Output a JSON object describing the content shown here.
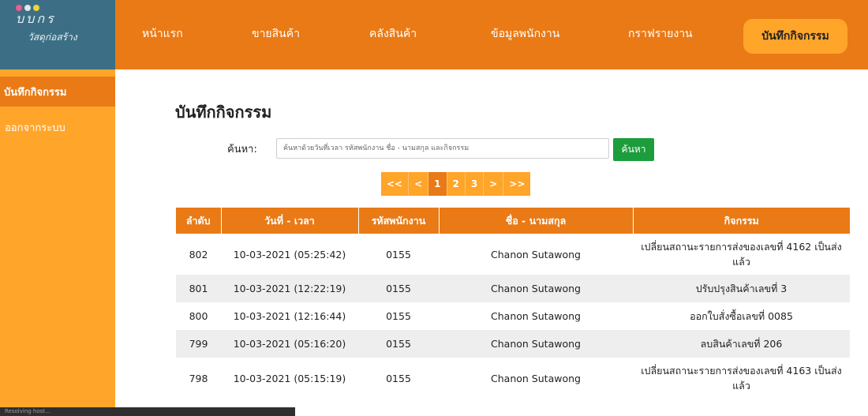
{
  "logo": {
    "title": "บบกร",
    "subtitle": "วัสดุก่อสร้าง",
    "dot_colors": [
      "#ef5a8f",
      "#e6e6e6",
      "#f2d23a"
    ]
  },
  "nav": {
    "items": [
      "หน้าแรก",
      "ขายสินค้า",
      "คลังสินค้า",
      "ข้อมูลพนักงาน",
      "กราฟรายงาน"
    ],
    "active": "บันทึกกิจกรรม"
  },
  "sidebar": {
    "active": "บันทึกกิจกรรม",
    "logout": "ออกจากระบบ"
  },
  "main": {
    "title": "บันทึกกิจกรรม",
    "search_label": "ค้นหา:",
    "search_placeholder": "ค้นหาด้วยวันที่เวลา รหัสพนักงาน ชื่อ - นามสกุล และกิจกรรม",
    "search_value": "",
    "search_button": "ค้นหา"
  },
  "pager": {
    "first": "<<",
    "prev": "<",
    "pages": [
      "1",
      "2",
      "3"
    ],
    "current": "1",
    "next": ">",
    "last": ">>"
  },
  "table": {
    "headers": [
      "ลำดับ",
      "วันที่ - เวลา",
      "รหัสพนักงาน",
      "ชื่อ - นามสกุล",
      "กิจกรรม"
    ],
    "rows": [
      [
        "802",
        "10-03-2021 (05:25:42)",
        "0155",
        "Chanon Sutawong",
        "เปลี่ยนสถานะรายการส่งของเลขที่ 4162 เป็นส่งแล้ว"
      ],
      [
        "801",
        "10-03-2021 (12:22:19)",
        "0155",
        "Chanon Sutawong",
        "ปรับปรุงสินค้าเลขที่ 3"
      ],
      [
        "800",
        "10-03-2021 (12:16:44)",
        "0155",
        "Chanon Sutawong",
        "ออกใบสั่งซื้อเลขที่ 0085"
      ],
      [
        "799",
        "10-03-2021 (05:16:20)",
        "0155",
        "Chanon Sutawong",
        "ลบสินค้าเลขที่ 206"
      ],
      [
        "798",
        "10-03-2021 (05:15:19)",
        "0155",
        "Chanon Sutawong",
        "เปลี่ยนสถานะรายการส่งของเลขที่ 4163 เป็นส่งแล้ว"
      ]
    ]
  },
  "status_bar": "Resolving host..."
}
